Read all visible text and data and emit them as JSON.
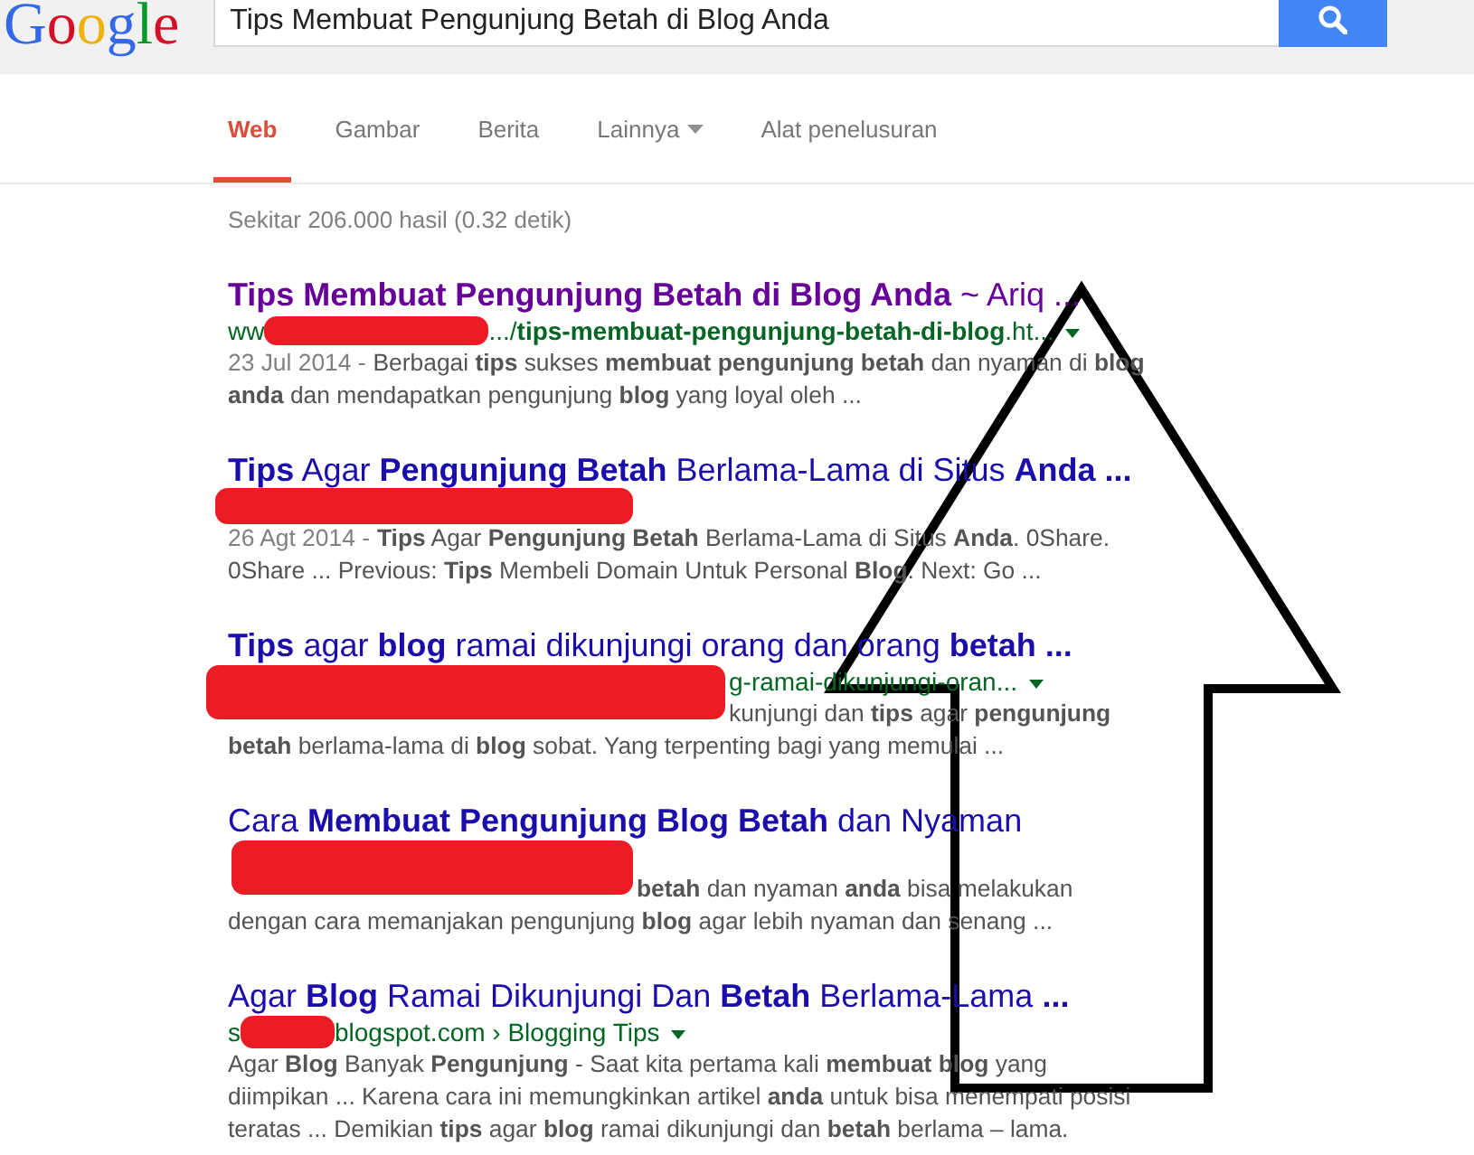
{
  "header": {
    "logo": "Google",
    "search": {
      "value": "Tips Membuat Pengunjung Betah di Blog Anda"
    }
  },
  "tabs": [
    {
      "label": "Web",
      "selected": true,
      "dropdown": false
    },
    {
      "label": "Gambar",
      "selected": false,
      "dropdown": false
    },
    {
      "label": "Berita",
      "selected": false,
      "dropdown": false
    },
    {
      "label": "Lainnya",
      "selected": false,
      "dropdown": true
    },
    {
      "label": "Alat penelusuran",
      "selected": false,
      "dropdown": false
    }
  ],
  "result_stats": "Sekitar 206.000 hasil (0.32 detik)",
  "results": [
    {
      "title": "**Tips Membuat Pengunjung Betah di Blog Anda** ~ Ariq ...",
      "visited": true,
      "redaction": {
        "kind": "inline"
      },
      "url": {
        "prefix": "ww",
        "suffix": ".../**tips-membuat-pengunjung-betah-di-blog**.ht...",
        "dropdown": true
      },
      "date": "23 Jul 2014 -",
      "snippet": "Berbagai **tips** sukses **membuat pengunjung betah** dan nyaman di **blog anda** dan mendapatkan pengunjung **blog** yang loyal oleh ..."
    },
    {
      "title": "**Tips** Agar **Pengunjung Betah** Berlama-Lama di Situs **Anda ...**",
      "visited": false,
      "redaction": {
        "kind": "inline"
      },
      "date": "26 Agt 2014 -",
      "snippet": "**Tips** Agar **Pengunjung Betah** Berlama-Lama di Situs **Anda**. 0Share. 0Share ... Previous: **Tips** Membeli Domain Untuk Personal **Blog**. Next: Go ..."
    },
    {
      "title": "**Tips** agar **blog** ramai dikunjungi orang dan orang **betah ...**",
      "visited": false,
      "redaction": {
        "kind": "tall"
      },
      "url": {
        "suffix": "g-ramai-dikunjungi-oran...",
        "dropdown": true
      },
      "snippet": "kunjungi dan **tips** agar **pengunjung betah** berlama-lama di **blog** sobat. Yang terpenting bagi yang memulai ..."
    },
    {
      "title": "Cara **Membuat Pengunjung Blog Betah** dan Nyaman",
      "visited": false,
      "redaction": {
        "kind": "tall"
      },
      "snippet": "**betah** dan nyaman **anda** bisa melakukan dengan cara memanjakan pengunjung **blog** agar lebih nyaman dan senang ..."
    },
    {
      "title": "Agar **Blog** Ramai Dikunjungi Dan **Betah** Berlama-Lama **...**",
      "visited": false,
      "redaction": {
        "kind": "inline"
      },
      "url": {
        "prefix": "s",
        "suffix": "blogspot.com › Blogging Tips",
        "dropdown": true
      },
      "snippet": "Agar **Blog** Banyak **Pengunjung** - Saat kita pertama kali **membuat blog** yang diimpikan ... Karena cara ini memungkinkan artikel **anda** untuk bisa menempati posisi teratas ... Demikian **tips** agar **blog** ramai dikunjungi dan **betah** berlama – lama."
    }
  ],
  "annotation": {
    "kind": "arrow"
  }
}
